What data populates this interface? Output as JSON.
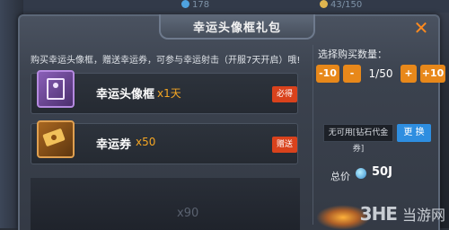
{
  "hud": {
    "stat1": "178",
    "stat2": "43/150"
  },
  "dialog": {
    "title": "幸运头像框礼包",
    "close_icon": "✕",
    "description": "购买幸运头像框，赠送幸运券，可参与幸运射击（开服7天开启）哦!",
    "rewards": [
      {
        "name": "幸运头像框",
        "qty": "x1天",
        "tag": "必得",
        "icon": "avatar-frame-icon"
      },
      {
        "name": "幸运券",
        "qty": "x50",
        "tag": "赠送",
        "icon": "lucky-ticket-icon"
      }
    ],
    "purchase": {
      "label": "选择购买数量：",
      "minus10": "-10",
      "minus1": "-",
      "quantity": "1/50",
      "plus1": "+",
      "plus10": "+10"
    },
    "voucher": {
      "status": "无可用[钻石代金券]",
      "change_label": "更 换"
    },
    "total": {
      "label": "总价",
      "value": "50J"
    },
    "ghost_text": "x90"
  },
  "watermark": {
    "logo": "3HE",
    "site": "当游网"
  },
  "colors": {
    "accent_orange": "#e8881a",
    "tag_red": "#d9421c",
    "button_blue": "#2e8ee0",
    "qty_gold": "#f5a623"
  }
}
